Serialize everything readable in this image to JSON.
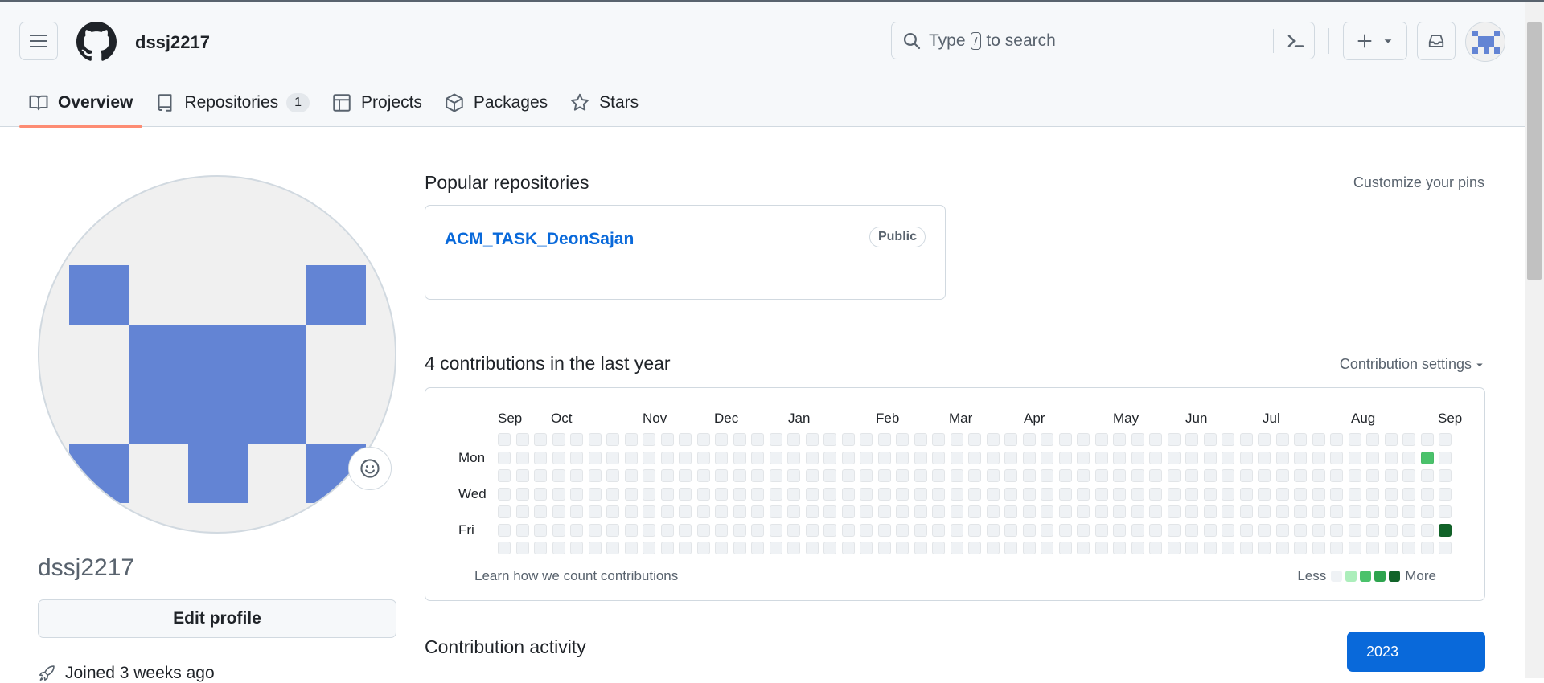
{
  "header": {
    "username": "dssj2217",
    "search": {
      "prefix": "Type",
      "key": "/",
      "suffix": "to search"
    }
  },
  "tabs": [
    {
      "label": "Overview",
      "icon": "book-icon",
      "selected": true
    },
    {
      "label": "Repositories",
      "icon": "repo-icon",
      "count": "1"
    },
    {
      "label": "Projects",
      "icon": "table-icon"
    },
    {
      "label": "Packages",
      "icon": "package-icon"
    },
    {
      "label": "Stars",
      "icon": "star-icon"
    }
  ],
  "sidebar": {
    "login": "dssj2217",
    "edit_profile": "Edit profile",
    "joined": "Joined 3 weeks ago"
  },
  "popular": {
    "title": "Popular repositories",
    "customize": "Customize your pins",
    "repo_name": "ACM_TASK_DeonSajan",
    "visibility": "Public"
  },
  "contributions": {
    "title": "4 contributions in the last year",
    "settings": "Contribution settings",
    "months": [
      "Sep",
      "Oct",
      "Nov",
      "Dec",
      "Jan",
      "Feb",
      "Mar",
      "Apr",
      "May",
      "Jun",
      "Jul",
      "Aug",
      "Sep"
    ],
    "days": [
      "Mon",
      "Wed",
      "Fri"
    ],
    "learn": "Learn how we count contributions",
    "less": "Less",
    "more": "More",
    "levels": [
      "#eff2f5",
      "#aceebb",
      "#4ac26b",
      "#2da44e",
      "#116329"
    ],
    "active_cells": [
      {
        "week": 51,
        "day": 1,
        "level": 2
      },
      {
        "week": 52,
        "day": 5,
        "level": 4
      }
    ]
  },
  "activity": {
    "title": "Contribution activity",
    "year": "2023"
  },
  "colors": {
    "accent": "#0969da",
    "tab_underline": "#fd8c73",
    "identicon": "#6384d4"
  }
}
